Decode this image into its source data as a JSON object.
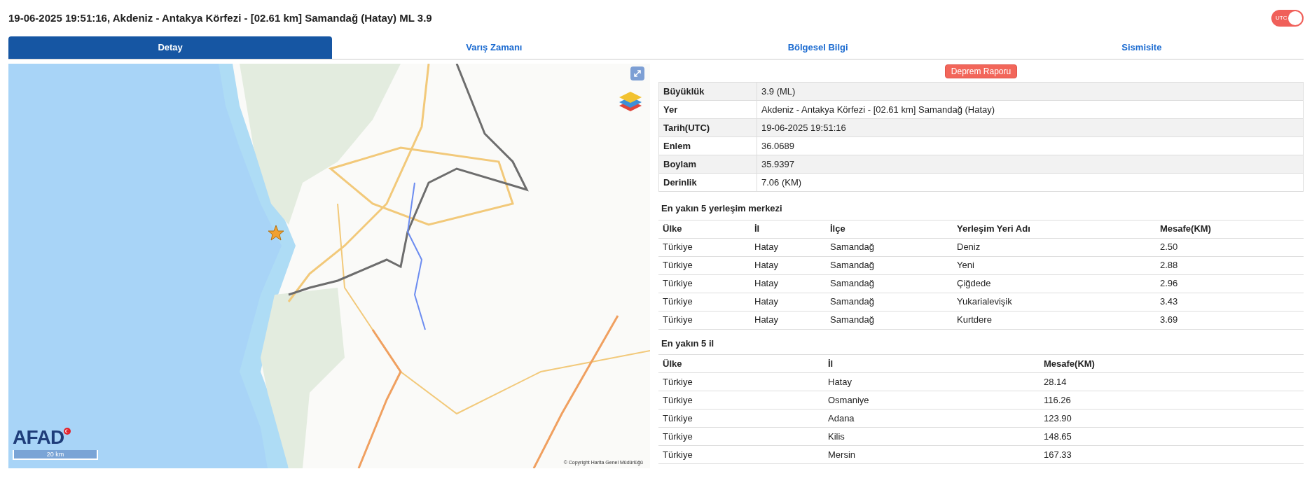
{
  "title": "19-06-2025 19:51:16, Akdeniz - Antakya Körfezi - [02.61 km] Samandağ (Hatay) ML 3.9",
  "utc_toggle": {
    "label": "UTC",
    "on": true
  },
  "tabs": [
    {
      "label": "Detay",
      "selected": true
    },
    {
      "label": "Varış Zamanı",
      "selected": false
    },
    {
      "label": "Bölgesel Bilgi",
      "selected": false
    },
    {
      "label": "Sismisite",
      "selected": false
    }
  ],
  "map": {
    "logo": "AFAD",
    "scale": "20 km",
    "copyright": "© Copyright Harita Genel Müdürlüğü"
  },
  "report_button": "Deprem Raporu",
  "details": [
    {
      "label": "Büyüklük",
      "value": "3.9 (ML)"
    },
    {
      "label": "Yer",
      "value": "Akdeniz - Antakya Körfezi - [02.61 km] Samandağ (Hatay)"
    },
    {
      "label": "Tarih(UTC)",
      "value": "19-06-2025 19:51:16"
    },
    {
      "label": "Enlem",
      "value": "36.0689"
    },
    {
      "label": "Boylam",
      "value": "35.9397"
    },
    {
      "label": "Derinlik",
      "value": "7.06 (KM)"
    }
  ],
  "settlements": {
    "title": "En yakın 5 yerleşim merkezi",
    "columns": [
      "Ülke",
      "İl",
      "İlçe",
      "Yerleşim Yeri Adı",
      "Mesafe(KM)"
    ],
    "rows": [
      [
        "Türkiye",
        "Hatay",
        "Samandağ",
        "Deniz",
        "2.50"
      ],
      [
        "Türkiye",
        "Hatay",
        "Samandağ",
        "Yeni",
        "2.88"
      ],
      [
        "Türkiye",
        "Hatay",
        "Samandağ",
        "Çiğdede",
        "2.96"
      ],
      [
        "Türkiye",
        "Hatay",
        "Samandağ",
        "Yukarialevişik",
        "3.43"
      ],
      [
        "Türkiye",
        "Hatay",
        "Samandağ",
        "Kurtdere",
        "3.69"
      ]
    ]
  },
  "provinces": {
    "title": "En yakın 5 il",
    "columns": [
      "Ülke",
      "İl",
      "Mesafe(KM)"
    ],
    "rows": [
      [
        "Türkiye",
        "Hatay",
        "28.14"
      ],
      [
        "Türkiye",
        "Osmaniye",
        "116.26"
      ],
      [
        "Türkiye",
        "Adana",
        "123.90"
      ],
      [
        "Türkiye",
        "Kilis",
        "148.65"
      ],
      [
        "Türkiye",
        "Mersin",
        "167.33"
      ]
    ]
  }
}
